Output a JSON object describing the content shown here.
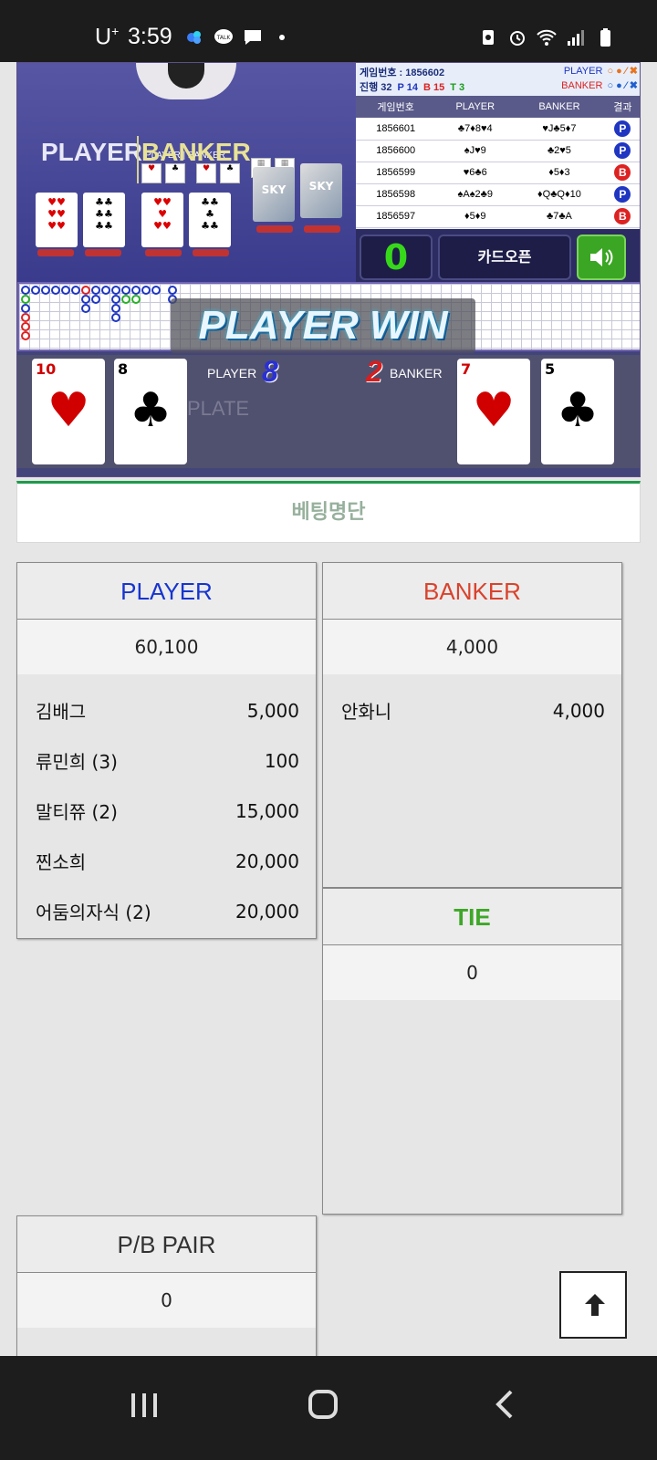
{
  "status_bar": {
    "carrier": "U",
    "carrier_plus": "+",
    "time": "3:59",
    "icons_left": [
      "plus-app-icon",
      "talk-icon",
      "chat-icon",
      "dot-icon"
    ],
    "icons_right": [
      "recycle-icon",
      "alarm-icon",
      "wifi-icon",
      "signal-icon",
      "battery-icon"
    ]
  },
  "video": {
    "mini_label": "PLAYER | BANKER",
    "title_player": "PLAYER",
    "title_banker": "BANKER",
    "shoe_text": "SKY"
  },
  "history": {
    "game_number_label": "게임번호 : 1856602",
    "progress_label": "진행 32",
    "p_count": "P 14",
    "b_count": "B 15",
    "t_count": "T 3",
    "legend_player": "PLAYER",
    "legend_banker": "BANKER",
    "legend_symbols": "○ ● ⁄ ✖",
    "columns": [
      "게임번호",
      "PLAYER",
      "BANKER",
      "결과"
    ],
    "rows": [
      {
        "no": "1856601",
        "player": "♣7♦8♥4",
        "banker": "♥J♣5♦7",
        "result": "P"
      },
      {
        "no": "1856600",
        "player": "♠J♥9",
        "banker": "♣2♥5",
        "result": "P"
      },
      {
        "no": "1856599",
        "player": "♥6♣6",
        "banker": "♦5♦3",
        "result": "B"
      },
      {
        "no": "1856598",
        "player": "♠A♠2♣9",
        "banker": "♦Q♣Q♦10",
        "result": "P"
      },
      {
        "no": "1856597",
        "player": "♦5♦9",
        "banker": "♣7♣A",
        "result": "B"
      }
    ],
    "counter": "0",
    "open_button": "카드오픈"
  },
  "banner": "PLAYER WIN",
  "result": {
    "player_label": "PLAYER",
    "player_score": "8",
    "banker_label": "BANKER",
    "banker_score": "2",
    "plate_text": "PLATE",
    "cards": [
      {
        "value": "10",
        "suit": "♥",
        "color": "#d00000"
      },
      {
        "value": "8",
        "suit": "♣",
        "color": "#000000"
      },
      {
        "value": "7",
        "suit": "♥",
        "color": "#d00000"
      },
      {
        "value": "5",
        "suit": "♣",
        "color": "#000000"
      }
    ]
  },
  "list_title": "베팅명단",
  "player_panel": {
    "title": "PLAYER",
    "total": "60,100",
    "rows": [
      {
        "name": "김배그",
        "amount": "5,000"
      },
      {
        "name": "류민희 (3)",
        "amount": "100"
      },
      {
        "name": "말티쮸 (2)",
        "amount": "15,000"
      },
      {
        "name": "찐소희",
        "amount": "20,000"
      },
      {
        "name": "어둠의자식 (2)",
        "amount": "20,000"
      }
    ]
  },
  "banker_panel": {
    "title": "BANKER",
    "total": "4,000",
    "rows": [
      {
        "name": "안화니",
        "amount": "4,000"
      }
    ]
  },
  "tie_panel": {
    "title": "TIE",
    "total": "0"
  },
  "pair_panel": {
    "title": "P/B PAIR",
    "total": "0"
  },
  "colors": {
    "player": "#1735cf",
    "banker": "#d9432d",
    "tie": "#3ea728",
    "accent_green": "#1f9a4b"
  }
}
